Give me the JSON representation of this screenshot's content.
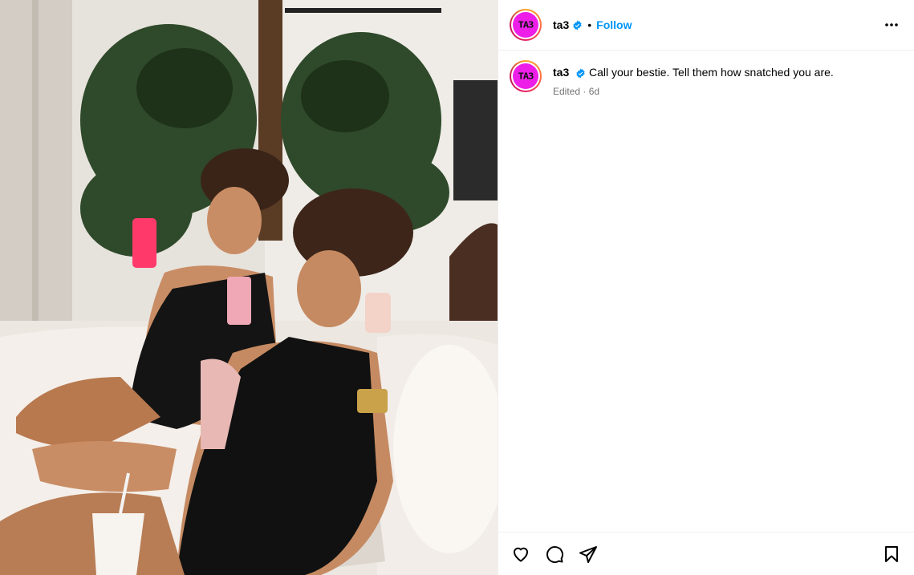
{
  "post": {
    "media_alt": "Two women in black swimsuits lounging on a white sofa",
    "header": {
      "username": "ta3",
      "avatar_text": "TA3",
      "verified": true,
      "separator": "•",
      "follow_label": "Follow",
      "more_icon": "more-horizontal-icon"
    },
    "caption": {
      "username": "ta3",
      "text": "Call your bestie. Tell them how snatched you are.",
      "meta": "Edited · 6d"
    },
    "actions": {
      "like_icon": "heart-icon",
      "comment_icon": "comment-icon",
      "share_icon": "share-icon",
      "save_icon": "bookmark-icon"
    }
  },
  "colors": {
    "accent_blue": "#0095f6",
    "avatar_pink": "#ec1ee7",
    "meta_gray": "#737373",
    "border": "#efefef"
  }
}
